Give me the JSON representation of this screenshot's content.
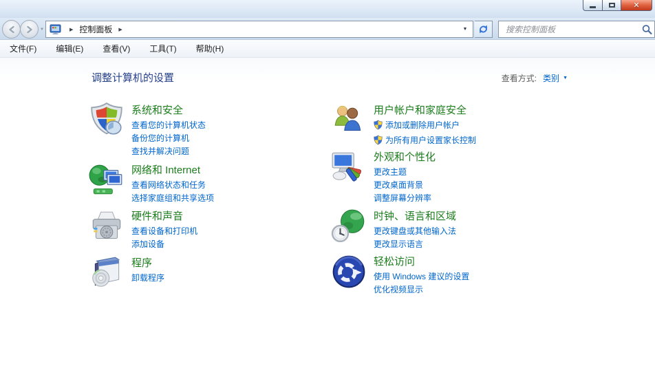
{
  "window": {
    "controls": {
      "minimize_icon": "minimize-icon",
      "maximize_icon": "maximize-icon",
      "close_glyph": "✕"
    }
  },
  "navigation": {
    "back_icon": "back-arrow-icon",
    "forward_icon": "forward-arrow-icon",
    "history_dropdown_glyph": "▼",
    "address": {
      "icon": "control-panel-icon",
      "arrow_glyph": "▶",
      "location": "控制面板",
      "dropdown_glyph": "▼"
    },
    "refresh_icon": "refresh-icon",
    "search": {
      "placeholder": "搜索控制面板",
      "icon": "magnifier-icon"
    }
  },
  "menu": {
    "items": [
      {
        "label": "文件(F)"
      },
      {
        "label": "编辑(E)"
      },
      {
        "label": "查看(V)"
      },
      {
        "label": "工具(T)"
      },
      {
        "label": "帮助(H)"
      }
    ]
  },
  "content": {
    "title": "调整计算机的设置",
    "view_by": {
      "label": "查看方式:",
      "value": "类别",
      "dropdown_glyph": "▼"
    },
    "categories": [
      {
        "title": "系统和安全",
        "icon": "system-security-icon",
        "links": [
          {
            "label": "查看您的计算机状态"
          },
          {
            "label": "备份您的计算机"
          },
          {
            "label": "查找并解决问题"
          }
        ]
      },
      {
        "title": "网络和 Internet",
        "icon": "network-internet-icon",
        "links": [
          {
            "label": "查看网络状态和任务"
          },
          {
            "label": "选择家庭组和共享选项"
          }
        ]
      },
      {
        "title": "硬件和声音",
        "icon": "hardware-sound-icon",
        "links": [
          {
            "label": "查看设备和打印机"
          },
          {
            "label": "添加设备"
          }
        ]
      },
      {
        "title": "程序",
        "icon": "programs-icon",
        "links": [
          {
            "label": "卸载程序"
          }
        ]
      },
      {
        "title": "用户帐户和家庭安全",
        "icon": "user-accounts-icon",
        "links": [
          {
            "label": "添加或删除用户帐户",
            "shield": true
          },
          {
            "label": "为所有用户设置家长控制",
            "shield": true
          }
        ]
      },
      {
        "title": "外观和个性化",
        "icon": "appearance-personalization-icon",
        "links": [
          {
            "label": "更改主题"
          },
          {
            "label": "更改桌面背景"
          },
          {
            "label": "调整屏幕分辨率"
          }
        ]
      },
      {
        "title": "时钟、语言和区域",
        "icon": "clock-language-region-icon",
        "links": [
          {
            "label": "更改键盘或其他输入法"
          },
          {
            "label": "更改显示语言"
          }
        ]
      },
      {
        "title": "轻松访问",
        "icon": "ease-of-access-icon",
        "links": [
          {
            "label": "使用 Windows 建议的设置"
          },
          {
            "label": "优化视频显示"
          }
        ]
      }
    ]
  },
  "colors": {
    "category_title_green": "#1c7d1c",
    "link_blue": "#0066cc",
    "header_navy": "#27418c",
    "close_button_red": "#d9553a"
  }
}
